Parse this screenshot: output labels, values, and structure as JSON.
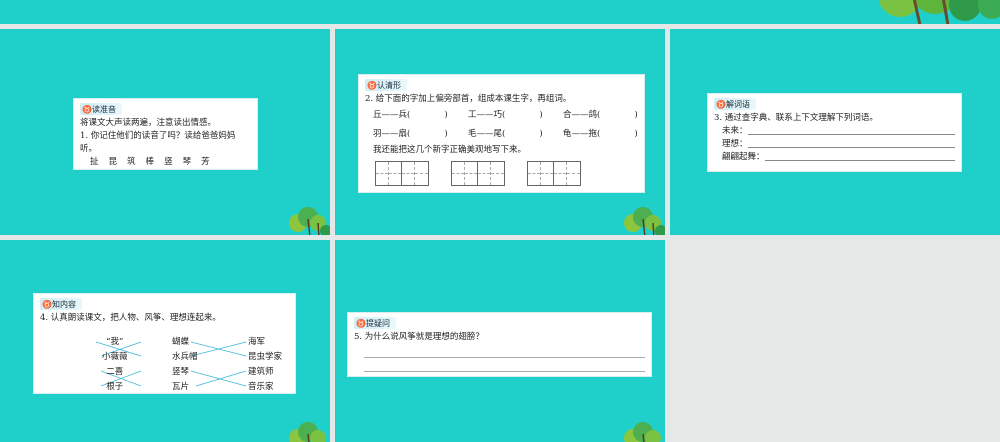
{
  "slides": [
    {
      "tag": "读准音",
      "intro": "将课文大声读两遍，注意读出情感。",
      "q": "1. 你记住他们的读音了吗？读给爸爸妈妈听。",
      "chars": [
        "扯",
        "昆",
        "筑",
        "棒",
        "竖",
        "琴",
        "芳"
      ]
    },
    {
      "tag": "认清形",
      "q": "2. 给下面的字加上偏旁部首，组成本课生字，再组词。",
      "pairs": [
        [
          "丘——兵(",
          ")"
        ],
        [
          "工——巧(",
          ")"
        ],
        [
          "合——鸽(",
          ")"
        ],
        [
          "羽——扇(",
          ")"
        ],
        [
          "毛——尾(",
          ")"
        ],
        [
          "龟——拖(",
          ")"
        ]
      ],
      "note": "我还能把这几个新字正确美观地写下来。"
    },
    {
      "tag": "解词语",
      "q": "3. 通过查字典、联系上下文理解下列词语。",
      "terms": [
        "未来：",
        "理想：",
        "翩翩起舞："
      ]
    },
    {
      "tag": "知内容",
      "q": "4. 认真朗读课文，把人物、风筝、理想连起来。",
      "col1": [
        "“我”",
        "小薇薇",
        "二喜",
        "根子"
      ],
      "col2": [
        "蝴蝶",
        "水兵帽",
        "竖琴",
        "瓦片"
      ],
      "col3": [
        "海军",
        "昆虫学家",
        "建筑师",
        "音乐家"
      ]
    },
    {
      "tag": "提疑问",
      "q": "5. 为什么说风筝就是理想的翅膀？"
    }
  ],
  "colors": {
    "teal": "#1ed0c9",
    "line": "#3fb6d6"
  }
}
